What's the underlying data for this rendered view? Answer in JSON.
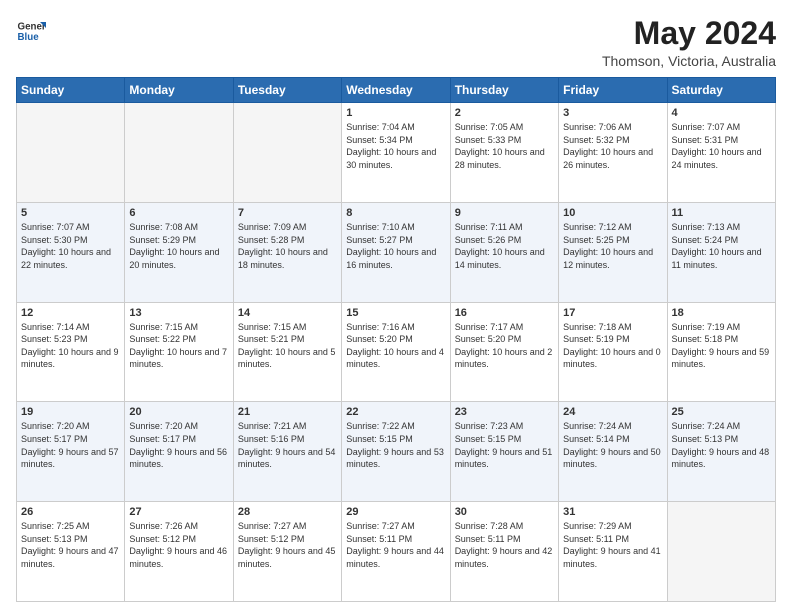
{
  "header": {
    "logo_general": "General",
    "logo_blue": "Blue",
    "month_year": "May 2024",
    "location": "Thomson, Victoria, Australia"
  },
  "weekdays": [
    "Sunday",
    "Monday",
    "Tuesday",
    "Wednesday",
    "Thursday",
    "Friday",
    "Saturday"
  ],
  "weeks": [
    [
      {
        "day": "",
        "empty": true
      },
      {
        "day": "",
        "empty": true
      },
      {
        "day": "",
        "empty": true
      },
      {
        "day": "1",
        "sunrise": "7:04 AM",
        "sunset": "5:34 PM",
        "daylight": "10 hours and 30 minutes."
      },
      {
        "day": "2",
        "sunrise": "7:05 AM",
        "sunset": "5:33 PM",
        "daylight": "10 hours and 28 minutes."
      },
      {
        "day": "3",
        "sunrise": "7:06 AM",
        "sunset": "5:32 PM",
        "daylight": "10 hours and 26 minutes."
      },
      {
        "day": "4",
        "sunrise": "7:07 AM",
        "sunset": "5:31 PM",
        "daylight": "10 hours and 24 minutes."
      }
    ],
    [
      {
        "day": "5",
        "sunrise": "7:07 AM",
        "sunset": "5:30 PM",
        "daylight": "10 hours and 22 minutes."
      },
      {
        "day": "6",
        "sunrise": "7:08 AM",
        "sunset": "5:29 PM",
        "daylight": "10 hours and 20 minutes."
      },
      {
        "day": "7",
        "sunrise": "7:09 AM",
        "sunset": "5:28 PM",
        "daylight": "10 hours and 18 minutes."
      },
      {
        "day": "8",
        "sunrise": "7:10 AM",
        "sunset": "5:27 PM",
        "daylight": "10 hours and 16 minutes."
      },
      {
        "day": "9",
        "sunrise": "7:11 AM",
        "sunset": "5:26 PM",
        "daylight": "10 hours and 14 minutes."
      },
      {
        "day": "10",
        "sunrise": "7:12 AM",
        "sunset": "5:25 PM",
        "daylight": "10 hours and 12 minutes."
      },
      {
        "day": "11",
        "sunrise": "7:13 AM",
        "sunset": "5:24 PM",
        "daylight": "10 hours and 11 minutes."
      }
    ],
    [
      {
        "day": "12",
        "sunrise": "7:14 AM",
        "sunset": "5:23 PM",
        "daylight": "10 hours and 9 minutes."
      },
      {
        "day": "13",
        "sunrise": "7:15 AM",
        "sunset": "5:22 PM",
        "daylight": "10 hours and 7 minutes."
      },
      {
        "day": "14",
        "sunrise": "7:15 AM",
        "sunset": "5:21 PM",
        "daylight": "10 hours and 5 minutes."
      },
      {
        "day": "15",
        "sunrise": "7:16 AM",
        "sunset": "5:20 PM",
        "daylight": "10 hours and 4 minutes."
      },
      {
        "day": "16",
        "sunrise": "7:17 AM",
        "sunset": "5:20 PM",
        "daylight": "10 hours and 2 minutes."
      },
      {
        "day": "17",
        "sunrise": "7:18 AM",
        "sunset": "5:19 PM",
        "daylight": "10 hours and 0 minutes."
      },
      {
        "day": "18",
        "sunrise": "7:19 AM",
        "sunset": "5:18 PM",
        "daylight": "9 hours and 59 minutes."
      }
    ],
    [
      {
        "day": "19",
        "sunrise": "7:20 AM",
        "sunset": "5:17 PM",
        "daylight": "9 hours and 57 minutes."
      },
      {
        "day": "20",
        "sunrise": "7:20 AM",
        "sunset": "5:17 PM",
        "daylight": "9 hours and 56 minutes."
      },
      {
        "day": "21",
        "sunrise": "7:21 AM",
        "sunset": "5:16 PM",
        "daylight": "9 hours and 54 minutes."
      },
      {
        "day": "22",
        "sunrise": "7:22 AM",
        "sunset": "5:15 PM",
        "daylight": "9 hours and 53 minutes."
      },
      {
        "day": "23",
        "sunrise": "7:23 AM",
        "sunset": "5:15 PM",
        "daylight": "9 hours and 51 minutes."
      },
      {
        "day": "24",
        "sunrise": "7:24 AM",
        "sunset": "5:14 PM",
        "daylight": "9 hours and 50 minutes."
      },
      {
        "day": "25",
        "sunrise": "7:24 AM",
        "sunset": "5:13 PM",
        "daylight": "9 hours and 48 minutes."
      }
    ],
    [
      {
        "day": "26",
        "sunrise": "7:25 AM",
        "sunset": "5:13 PM",
        "daylight": "9 hours and 47 minutes."
      },
      {
        "day": "27",
        "sunrise": "7:26 AM",
        "sunset": "5:12 PM",
        "daylight": "9 hours and 46 minutes."
      },
      {
        "day": "28",
        "sunrise": "7:27 AM",
        "sunset": "5:12 PM",
        "daylight": "9 hours and 45 minutes."
      },
      {
        "day": "29",
        "sunrise": "7:27 AM",
        "sunset": "5:11 PM",
        "daylight": "9 hours and 44 minutes."
      },
      {
        "day": "30",
        "sunrise": "7:28 AM",
        "sunset": "5:11 PM",
        "daylight": "9 hours and 42 minutes."
      },
      {
        "day": "31",
        "sunrise": "7:29 AM",
        "sunset": "5:11 PM",
        "daylight": "9 hours and 41 minutes."
      },
      {
        "day": "",
        "empty": true
      }
    ]
  ]
}
